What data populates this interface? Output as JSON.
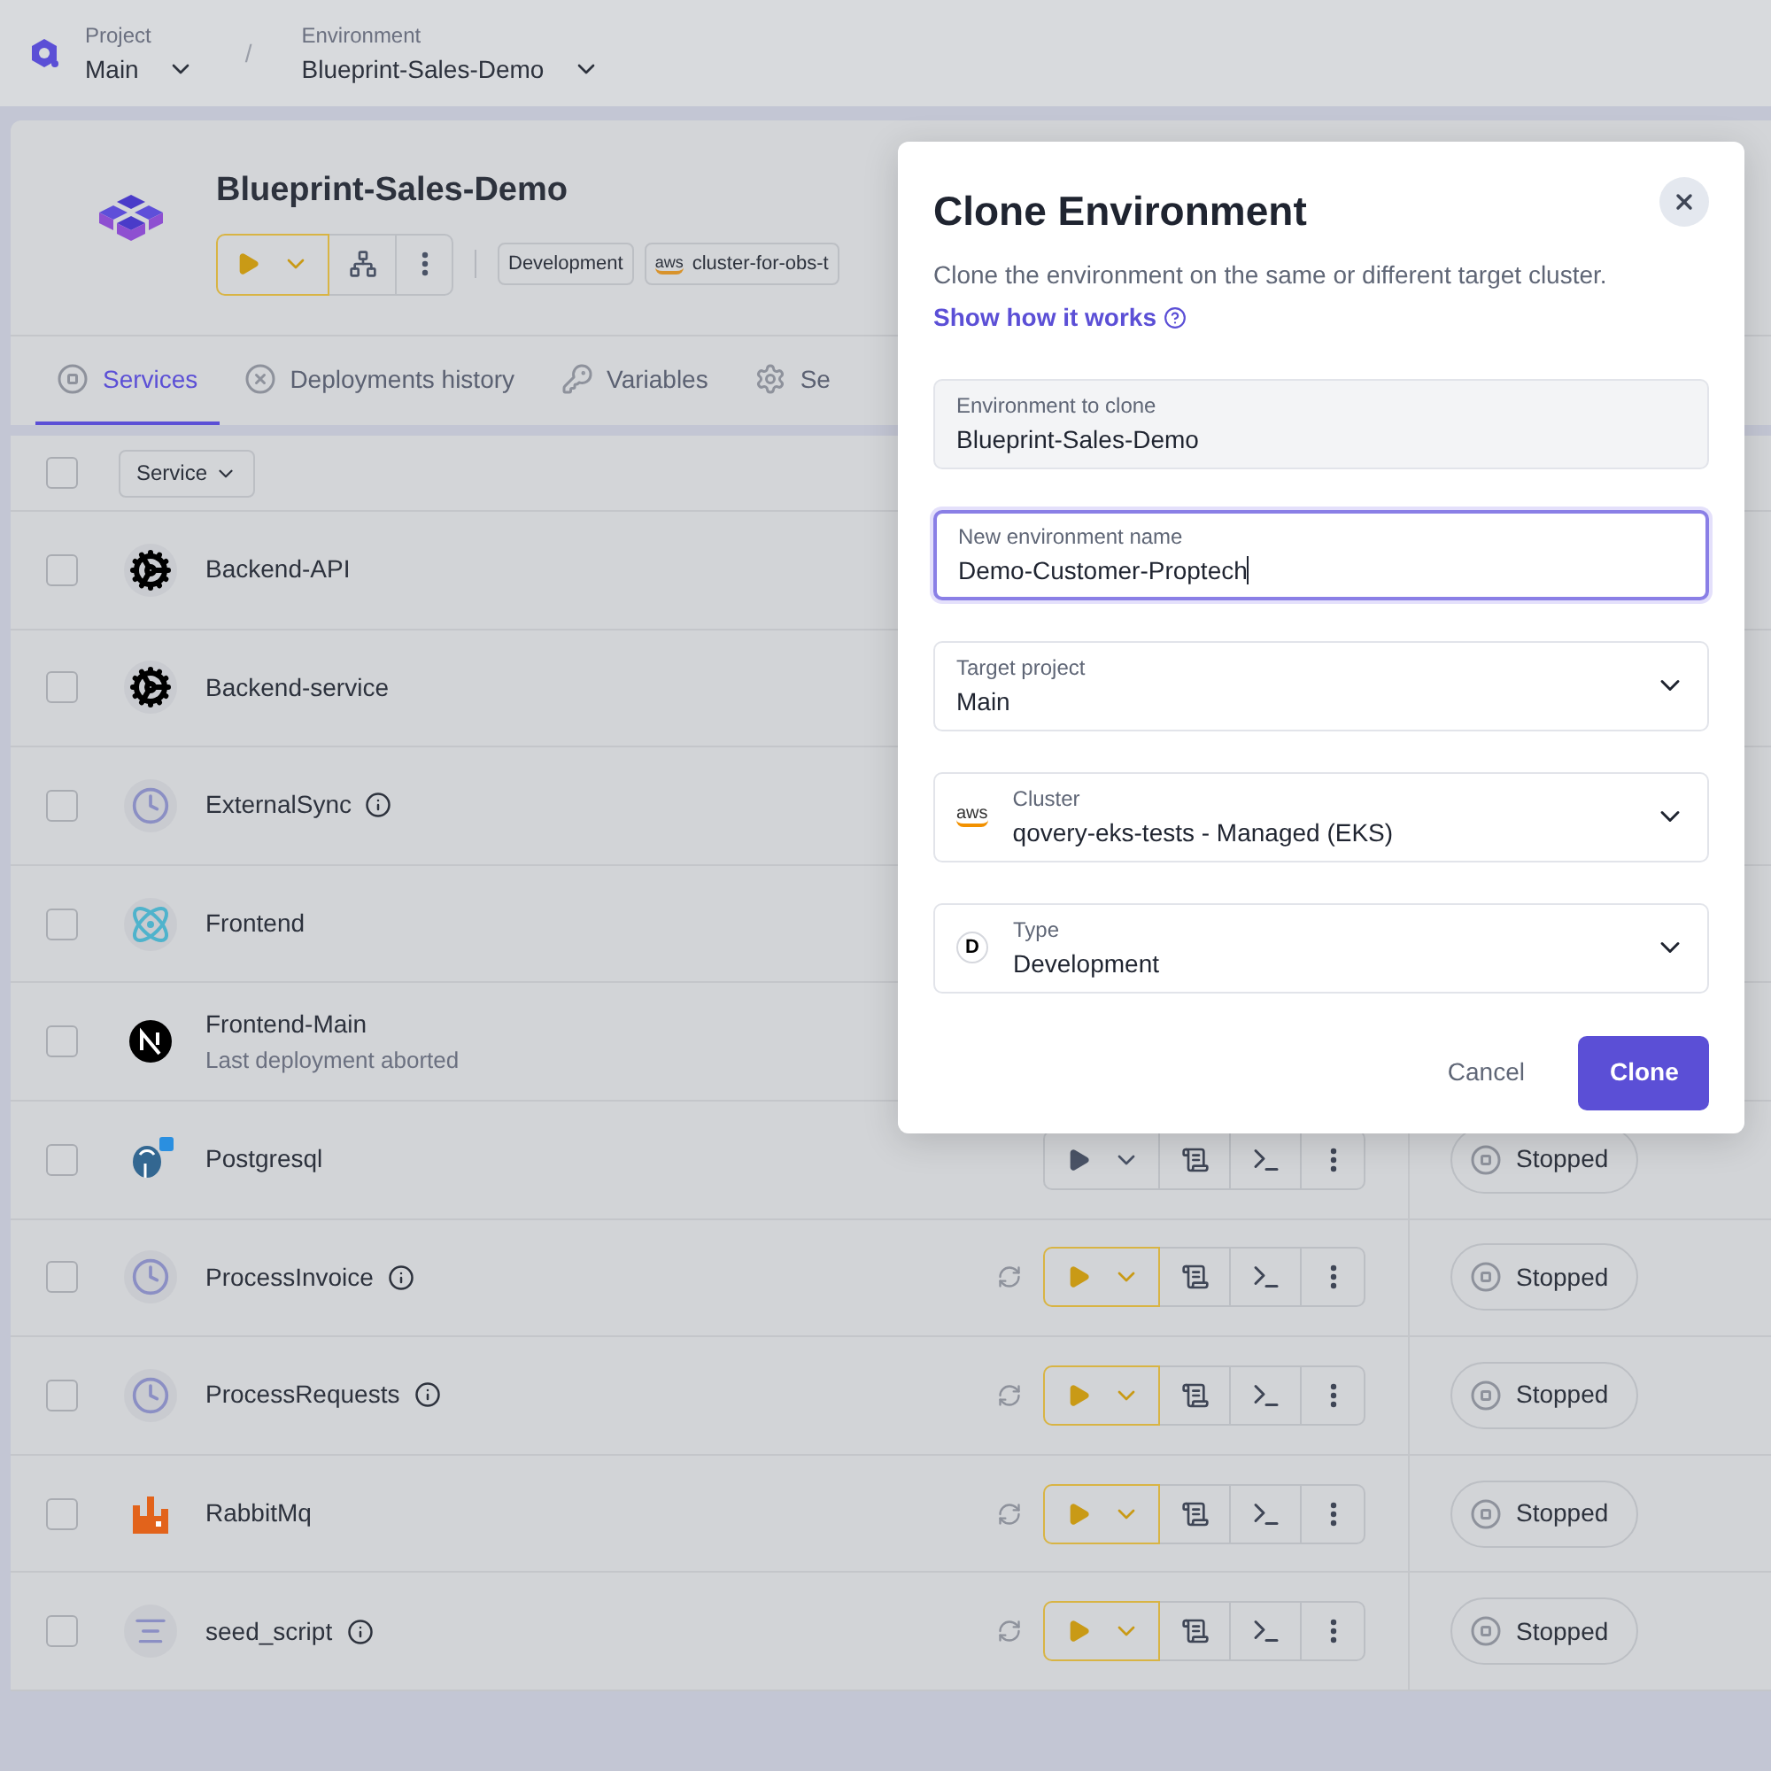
{
  "breadcrumb": [
    {
      "label": "Project",
      "value": "Main"
    },
    {
      "label": "Environment",
      "value": "Blueprint-Sales-Demo"
    }
  ],
  "separator": "/",
  "environment": {
    "title": "Blueprint-Sales-Demo",
    "deploy_highlighted": true,
    "badges": [
      {
        "text": "Development"
      },
      {
        "text": "cluster-for-obs-t",
        "logo_text": "aws"
      }
    ]
  },
  "tabs": [
    {
      "label": "Services",
      "selected": true
    },
    {
      "label": "Deployments history",
      "selected": false
    },
    {
      "label": "Variables",
      "selected": false
    },
    {
      "label": "Se",
      "selected": false
    }
  ],
  "table": {
    "select_all_checked": false,
    "sort_column": "Service",
    "rows": [
      {
        "name": "Backend-API",
        "kind": "rust",
        "info": false,
        "checked": false
      },
      {
        "name": "Backend-service",
        "kind": "rust",
        "info": false,
        "checked": false
      },
      {
        "name": "ExternalSync",
        "kind": "cron",
        "info": true,
        "checked": false
      },
      {
        "name": "Frontend",
        "kind": "react",
        "info": false,
        "checked": false
      },
      {
        "name": "Frontend-Main",
        "subtitle": "Last deployment aborted",
        "kind": "next",
        "info": false,
        "checked": false
      },
      {
        "name": "Postgresql",
        "kind": "postgres",
        "info": false,
        "sync": false,
        "checked": false,
        "deploy_highlighted": false,
        "status": "Stopped"
      },
      {
        "name": "ProcessInvoice",
        "kind": "cron",
        "info": true,
        "sync": true,
        "checked": false,
        "deploy_highlighted": true,
        "status": "Stopped"
      },
      {
        "name": "ProcessRequests",
        "kind": "cron",
        "info": true,
        "sync": true,
        "checked": false,
        "deploy_highlighted": true,
        "status": "Stopped"
      },
      {
        "name": "RabbitMq",
        "kind": "rabbit",
        "info": false,
        "sync": true,
        "checked": false,
        "deploy_highlighted": true,
        "status": "Stopped"
      },
      {
        "name": "seed_script",
        "kind": "script",
        "info": true,
        "sync": true,
        "checked": false,
        "deploy_highlighted": true,
        "status": "Stopped"
      }
    ]
  },
  "dialog": {
    "title": "Clone Environment",
    "description": "Clone the environment on the same or different target cluster.",
    "link": "Show how it works",
    "fields": [
      {
        "kind": "text",
        "label": "Environment to clone",
        "value": "Blueprint-Sales-Demo",
        "disabled": true,
        "focused": false
      },
      {
        "kind": "text",
        "label": "New environment name",
        "value": "Demo-Customer-Proptech",
        "disabled": false,
        "focused": true
      },
      {
        "kind": "select",
        "label": "Target project",
        "value": "Main"
      },
      {
        "kind": "select",
        "label": "Cluster",
        "value": "qovery-eks-tests - Managed (EKS)",
        "logo_text": "aws"
      },
      {
        "kind": "select",
        "label": "Type",
        "value": "Development",
        "badge": "D"
      }
    ],
    "buttons": [
      {
        "label": "Cancel",
        "kind": "secondary"
      },
      {
        "label": "Clone",
        "kind": "primary"
      }
    ]
  }
}
